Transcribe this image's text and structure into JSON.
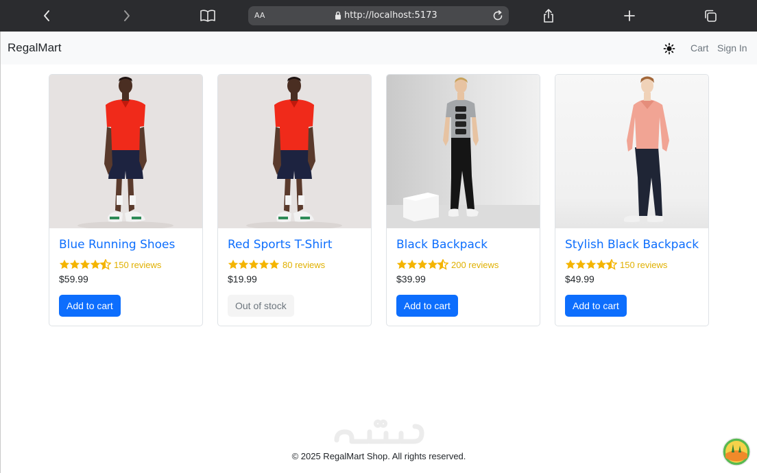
{
  "browser": {
    "url": "http://localhost:5173",
    "text_size_label": "AA"
  },
  "navbar": {
    "brand": "RegalMart",
    "cart_label": "Cart",
    "signin_label": "Sign In"
  },
  "products": [
    {
      "title": "Blue Running Shoes",
      "rating": 4.5,
      "reviews": "150 reviews",
      "price": "$59.99",
      "action": "Add to cart",
      "in_stock": true,
      "image": "man in red polo shirt and navy shorts"
    },
    {
      "title": "Red Sports T-Shirt",
      "rating": 5,
      "reviews": "80 reviews",
      "price": "$19.99",
      "action": "Out of stock",
      "in_stock": false,
      "image": "man in red polo shirt and navy shorts"
    },
    {
      "title": "Black Backpack",
      "rating": 4.5,
      "reviews": "200 reviews",
      "price": "$39.99",
      "action": "Add to cart",
      "in_stock": true,
      "image": "man in grey graphic t-shirt and black pants"
    },
    {
      "title": "Stylish Black Backpack",
      "rating": 4.5,
      "reviews": "150 reviews",
      "price": "$49.99",
      "action": "Add to cart",
      "in_stock": true,
      "image": "man in pink sweater and dark jeans"
    }
  ],
  "footer": {
    "copyright": "© 2025 RegalMart Shop. All rights reserved."
  },
  "colors": {
    "primary": "#0d6efd",
    "star": "#f4b400",
    "navbar_bg": "#f8f9fa",
    "chrome_bg": "#2b2c2f"
  },
  "icons": [
    "back-icon",
    "forward-icon",
    "bookmarks-icon",
    "lock-icon",
    "reload-icon",
    "share-icon",
    "new-tab-icon",
    "tabs-icon",
    "theme-toggle-icon"
  ]
}
